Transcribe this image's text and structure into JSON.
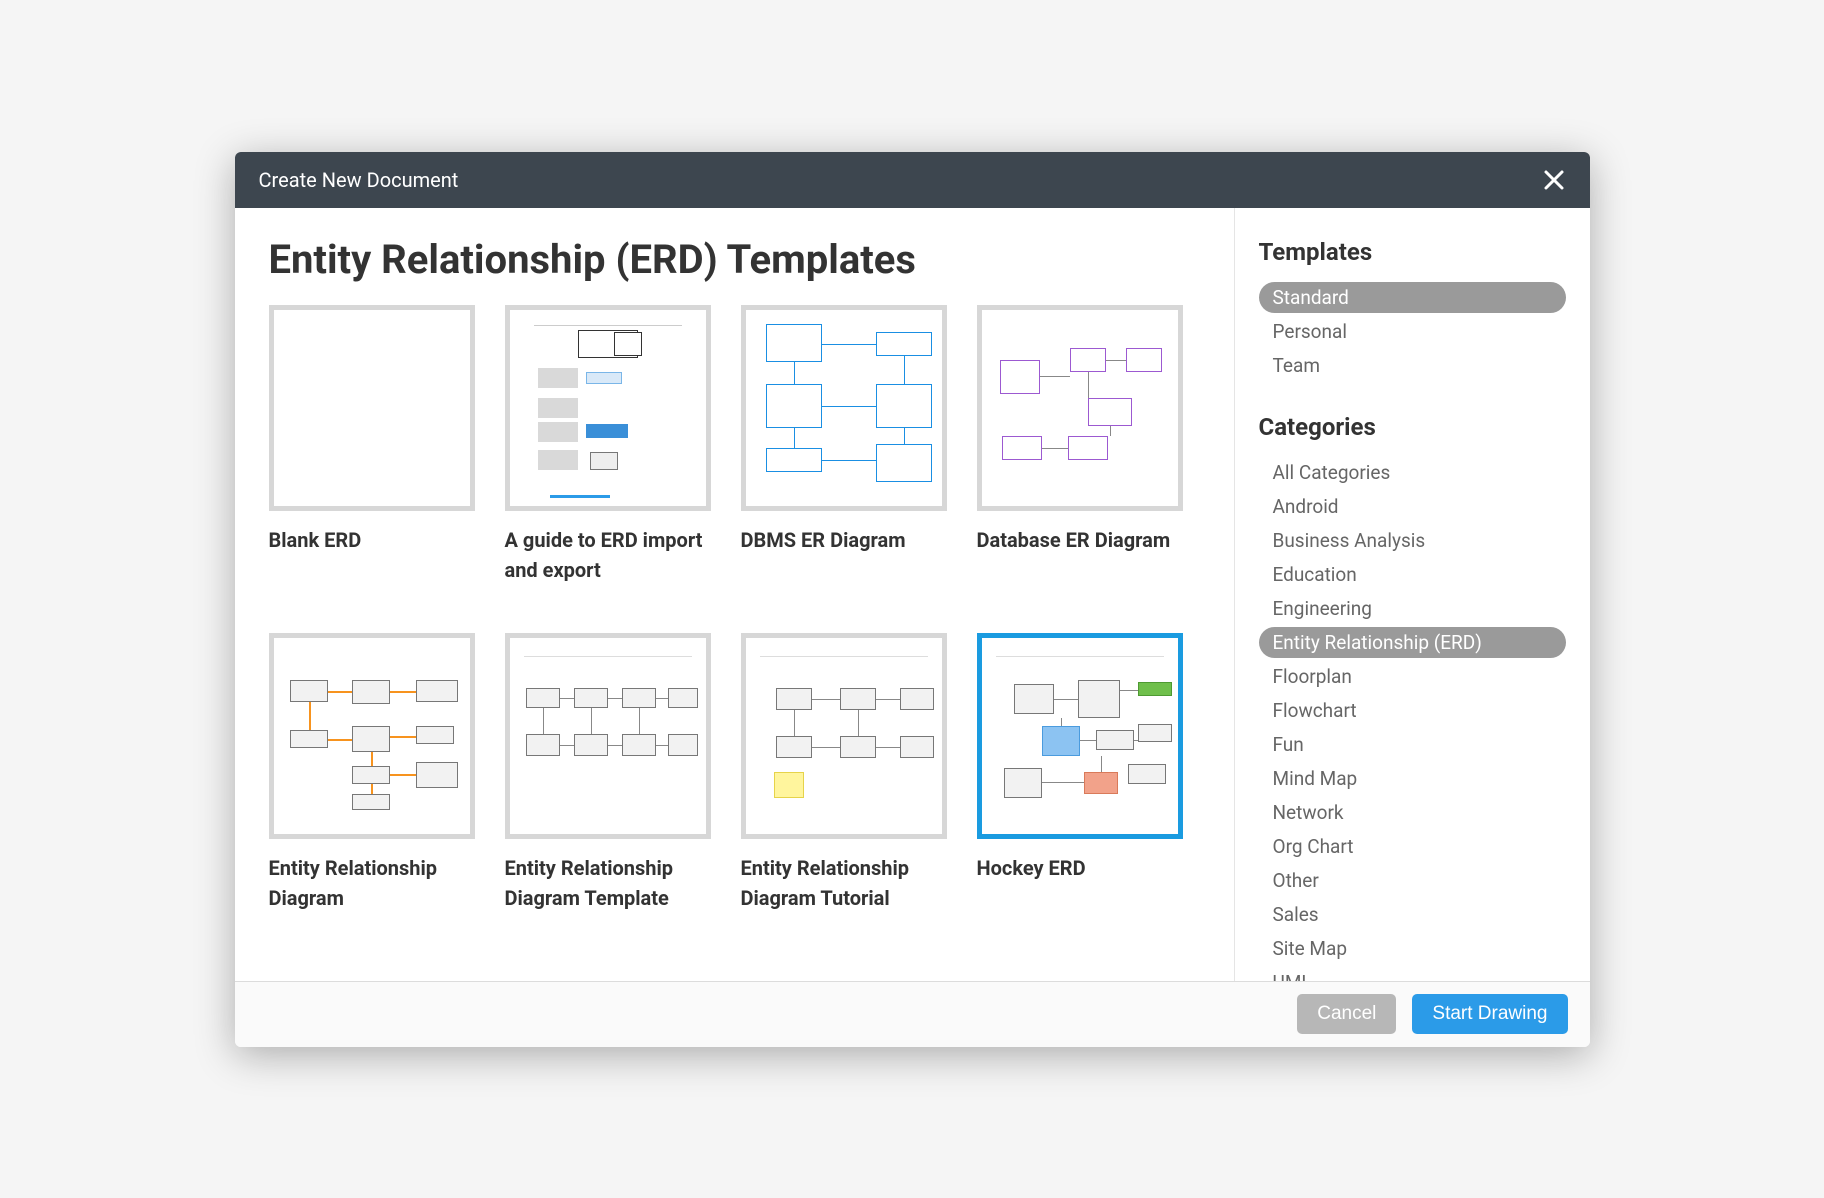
{
  "dialog": {
    "title": "Create New Document"
  },
  "main": {
    "page_title": "Entity Relationship (ERD) Templates",
    "templates": [
      {
        "label": "Blank ERD",
        "selected": false
      },
      {
        "label": "A guide to ERD import and export",
        "selected": false
      },
      {
        "label": "DBMS ER Diagram",
        "selected": false
      },
      {
        "label": "Database ER Diagram",
        "selected": false
      },
      {
        "label": "Entity Relationship Diagram",
        "selected": false
      },
      {
        "label": "Entity Relationship Diagram Template",
        "selected": false
      },
      {
        "label": "Entity Relationship Diagram Tutorial",
        "selected": false
      },
      {
        "label": "Hockey ERD",
        "selected": true
      }
    ]
  },
  "sidebar": {
    "templates_heading": "Templates",
    "template_groups": [
      {
        "label": "Standard",
        "active": true
      },
      {
        "label": "Personal",
        "active": false
      },
      {
        "label": "Team",
        "active": false
      }
    ],
    "categories_heading": "Categories",
    "categories": [
      {
        "label": "All Categories",
        "active": false
      },
      {
        "label": "Android",
        "active": false
      },
      {
        "label": "Business Analysis",
        "active": false
      },
      {
        "label": "Education",
        "active": false
      },
      {
        "label": "Engineering",
        "active": false
      },
      {
        "label": "Entity Relationship (ERD)",
        "active": true
      },
      {
        "label": "Floorplan",
        "active": false
      },
      {
        "label": "Flowchart",
        "active": false
      },
      {
        "label": "Fun",
        "active": false
      },
      {
        "label": "Mind Map",
        "active": false
      },
      {
        "label": "Network",
        "active": false
      },
      {
        "label": "Org Chart",
        "active": false
      },
      {
        "label": "Other",
        "active": false
      },
      {
        "label": "Sales",
        "active": false
      },
      {
        "label": "Site Map",
        "active": false
      },
      {
        "label": "UML",
        "active": false
      }
    ]
  },
  "footer": {
    "cancel": "Cancel",
    "start": "Start Drawing"
  }
}
